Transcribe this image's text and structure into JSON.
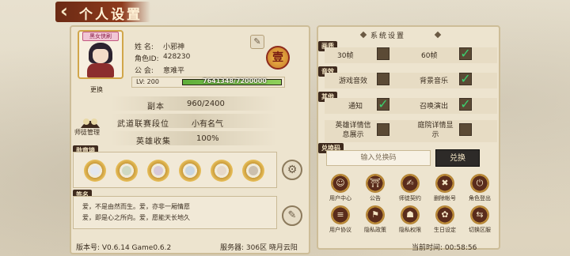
{
  "header": {
    "back_icon": "chevron-left-icon",
    "title": "个人设置"
  },
  "profile": {
    "avatar_tag": "黑女侠刷",
    "change_label": "更换",
    "name_label": "姓 名:",
    "name": "小邪神",
    "id_label": "角色ID:",
    "id": "428230",
    "guild_label": "公 会:",
    "guild": "意难平",
    "lv_label": "LV: 200",
    "exp_text": "7641348/7200000",
    "exp_progress": 1.0,
    "emblem_char": "壹"
  },
  "stats": [
    {
      "label": "副本",
      "value": "960/2400"
    },
    {
      "label": "武道联赛段位",
      "value": "小有名气"
    },
    {
      "label": "英雄收集",
      "value": "100%"
    }
  ],
  "mentor_label": "师徒管理",
  "medals_label": "勋章墙",
  "medals_count": 6,
  "signature_label": "签名",
  "signature_lines": [
    "爱，不是由然而生。爱，亦非一厢情愿",
    "爱，即是心之所向。爱，愿能天长地久"
  ],
  "system": {
    "header": "系统设置",
    "sections": {
      "picture": "画质",
      "sound": "音效",
      "other": "其他"
    },
    "options": [
      {
        "left_label": "30帧",
        "left_checked": false,
        "right_label": "60帧",
        "right_checked": true
      },
      {
        "left_label": "游戏音效",
        "left_checked": false,
        "right_label": "背景音乐",
        "right_checked": true
      },
      {
        "left_label": "通知",
        "left_checked": true,
        "right_label": "召唤演出",
        "right_checked": true
      },
      {
        "left_label": "英雄详情信息展示",
        "left_checked": false,
        "right_label": "庭院详情显示",
        "right_checked": false
      }
    ],
    "redeem_section": "兑换码",
    "redeem_placeholder": "输入兑换码",
    "redeem_button": "兑换",
    "buttons_row1": [
      {
        "label": "用户中心",
        "icon": "user-center-icon",
        "glyph": "☺"
      },
      {
        "label": "公告",
        "icon": "notice-icon",
        "glyph": "⛩"
      },
      {
        "label": "师徒契约",
        "icon": "contract-icon",
        "glyph": "✍"
      },
      {
        "label": "删除帐号",
        "icon": "delete-account-icon",
        "glyph": "✖"
      },
      {
        "label": "角色登出",
        "icon": "logout-icon",
        "glyph": "⏻"
      }
    ],
    "buttons_row2": [
      {
        "label": "用户协议",
        "icon": "agreement-icon",
        "glyph": "≡"
      },
      {
        "label": "隐私政策",
        "icon": "privacy-policy-icon",
        "glyph": "⚑"
      },
      {
        "label": "隐私权限",
        "icon": "privacy-permission-icon",
        "glyph": "☗"
      },
      {
        "label": "生日设定",
        "icon": "birthday-icon",
        "glyph": "✿"
      },
      {
        "label": "切换区服",
        "icon": "switch-server-icon",
        "glyph": "⇆"
      }
    ]
  },
  "footer": {
    "version": "版本号: V0.6.14 Game0.6.2",
    "server": "服务器: 306区 晓月云阳",
    "time": "当前时间: 00:58:56"
  }
}
